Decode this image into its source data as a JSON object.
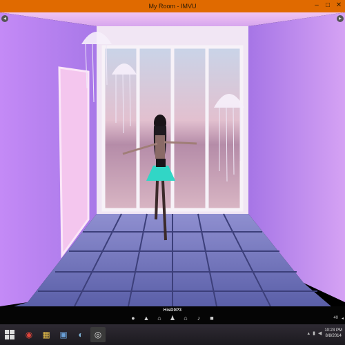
{
  "window": {
    "title": "My Room - IMVU",
    "controls": {
      "minimize": "–",
      "maximize": "□",
      "close": "✕"
    }
  },
  "scene": {
    "description_free": true,
    "colors": {
      "wall": "#b77bf0",
      "floor": "#6a6fb5",
      "ceiling": "#e7b3ef",
      "door": "#f2c7ef",
      "window_frame": "#f4eef6"
    }
  },
  "gamebar": {
    "username": "HisD0P3",
    "tools": [
      {
        "name": "chat-bubble-icon",
        "glyph": "●"
      },
      {
        "name": "shirt-icon",
        "glyph": "▲"
      },
      {
        "name": "hanger-icon",
        "glyph": "⌂"
      },
      {
        "name": "person-icon",
        "glyph": "♟"
      },
      {
        "name": "home-icon",
        "glyph": "⌂"
      },
      {
        "name": "music-icon",
        "glyph": "♪"
      },
      {
        "name": "shop-bag-icon",
        "glyph": "■"
      }
    ],
    "right_number": "40"
  },
  "taskbar": {
    "apps": [
      {
        "name": "chrome-icon",
        "glyph": "◉",
        "color": "#e0443a"
      },
      {
        "name": "file-explorer-icon",
        "glyph": "▦",
        "color": "#e8c04a"
      },
      {
        "name": "photos-icon",
        "glyph": "▣",
        "color": "#6aa0d8"
      },
      {
        "name": "media-player-icon",
        "glyph": "◐",
        "color": "#7fb3d6"
      },
      {
        "name": "imvu-icon",
        "glyph": "◎",
        "color": "#dcdcdc"
      }
    ],
    "clock_time": "10:23 PM",
    "clock_date": "8/8/2014"
  }
}
